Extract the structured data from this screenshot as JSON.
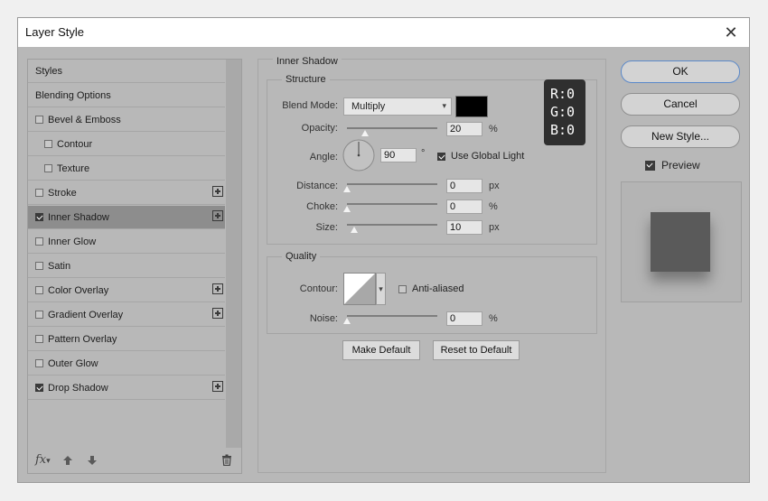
{
  "window": {
    "title": "Layer Style",
    "close_label": "✕"
  },
  "style_list": {
    "items": [
      {
        "label": "Styles",
        "checkbox": false,
        "checked": false,
        "plus": false,
        "selected": false,
        "indent": 0
      },
      {
        "label": "Blending Options",
        "checkbox": false,
        "checked": false,
        "plus": false,
        "selected": false,
        "indent": 0
      },
      {
        "label": "Bevel & Emboss",
        "checkbox": true,
        "checked": false,
        "plus": false,
        "selected": false,
        "indent": 0
      },
      {
        "label": "Contour",
        "checkbox": true,
        "checked": false,
        "plus": false,
        "selected": false,
        "indent": 1
      },
      {
        "label": "Texture",
        "checkbox": true,
        "checked": false,
        "plus": false,
        "selected": false,
        "indent": 1
      },
      {
        "label": "Stroke",
        "checkbox": true,
        "checked": false,
        "plus": true,
        "selected": false,
        "indent": 0
      },
      {
        "label": "Inner Shadow",
        "checkbox": true,
        "checked": true,
        "plus": true,
        "selected": true,
        "indent": 0
      },
      {
        "label": "Inner Glow",
        "checkbox": true,
        "checked": false,
        "plus": false,
        "selected": false,
        "indent": 0
      },
      {
        "label": "Satin",
        "checkbox": true,
        "checked": false,
        "plus": false,
        "selected": false,
        "indent": 0
      },
      {
        "label": "Color Overlay",
        "checkbox": true,
        "checked": false,
        "plus": true,
        "selected": false,
        "indent": 0
      },
      {
        "label": "Gradient Overlay",
        "checkbox": true,
        "checked": false,
        "plus": true,
        "selected": false,
        "indent": 0
      },
      {
        "label": "Pattern Overlay",
        "checkbox": true,
        "checked": false,
        "plus": false,
        "selected": false,
        "indent": 0
      },
      {
        "label": "Outer Glow",
        "checkbox": true,
        "checked": false,
        "plus": false,
        "selected": false,
        "indent": 0
      },
      {
        "label": "Drop Shadow",
        "checkbox": true,
        "checked": true,
        "plus": true,
        "selected": false,
        "indent": 0
      }
    ],
    "footer": {
      "fx_label": "fx",
      "up_icon": "arrow-up-icon",
      "down_icon": "arrow-down-icon",
      "trash_icon": "trash-icon"
    }
  },
  "inner_shadow": {
    "title": "Inner Shadow",
    "structure": {
      "legend": "Structure",
      "blend_mode_label": "Blend Mode:",
      "blend_mode_value": "Multiply",
      "shadow_color": "#000000",
      "opacity_label": "Opacity:",
      "opacity_value": "20",
      "opacity_unit": "%",
      "opacity_fraction": 0.2,
      "angle_label": "Angle:",
      "angle_value": "90",
      "angle_unit": "°",
      "global_light_label": "Use Global Light",
      "global_light_checked": true,
      "distance_label": "Distance:",
      "distance_value": "0",
      "distance_unit": "px",
      "distance_fraction": 0.0,
      "choke_label": "Choke:",
      "choke_value": "0",
      "choke_unit": "%",
      "choke_fraction": 0.0,
      "size_label": "Size:",
      "size_value": "10",
      "size_unit": "px",
      "size_fraction": 0.08
    },
    "quality": {
      "legend": "Quality",
      "contour_label": "Contour:",
      "anti_aliased_label": "Anti-aliased",
      "anti_aliased_checked": false,
      "noise_label": "Noise:",
      "noise_value": "0",
      "noise_unit": "%",
      "noise_fraction": 0.0
    },
    "make_default_label": "Make Default",
    "reset_default_label": "Reset to Default"
  },
  "color_readout": {
    "r": "R:0",
    "g": "G:0",
    "b": "B:0"
  },
  "buttons": {
    "ok": "OK",
    "cancel": "Cancel",
    "new_style": "New Style..."
  },
  "preview": {
    "label": "Preview",
    "checked": true,
    "swatch_color": "#5a5a5a"
  }
}
